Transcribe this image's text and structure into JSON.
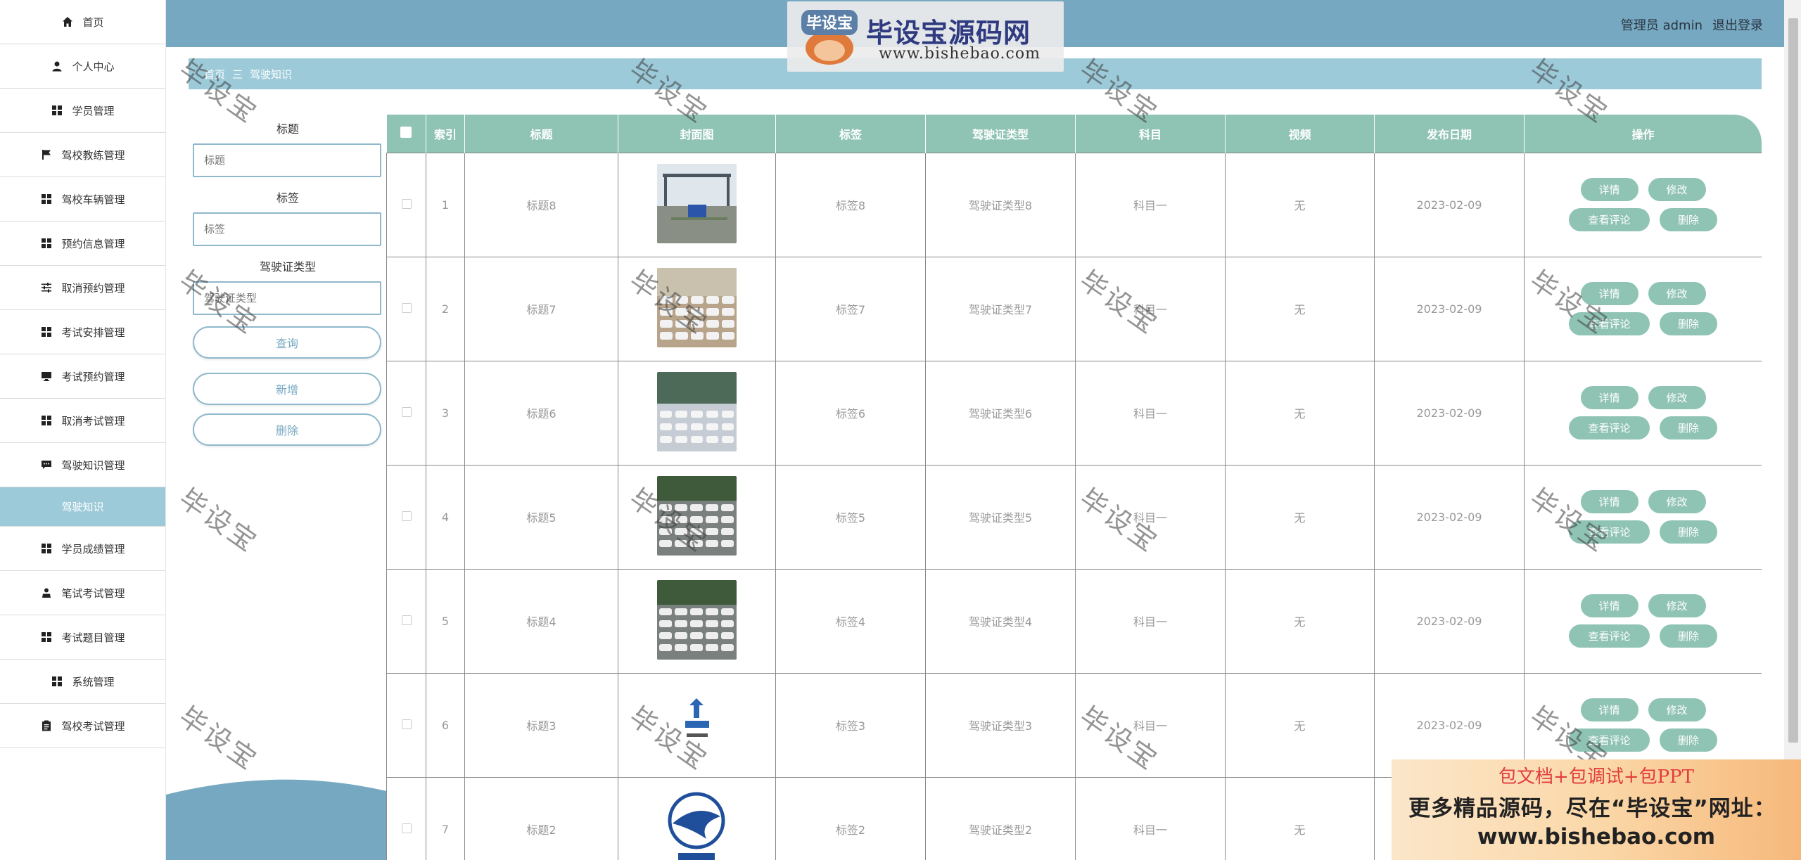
{
  "sidebar": {
    "items": [
      {
        "label": "首页",
        "icon": "home-icon"
      },
      {
        "label": "个人中心",
        "icon": "user-icon"
      },
      {
        "label": "学员管理",
        "icon": "grid-icon"
      },
      {
        "label": "驾校教练管理",
        "icon": "flag-icon"
      },
      {
        "label": "驾校车辆管理",
        "icon": "grid-icon"
      },
      {
        "label": "预约信息管理",
        "icon": "grid-icon"
      },
      {
        "label": "取消预约管理",
        "icon": "sliders-icon"
      },
      {
        "label": "考试安排管理",
        "icon": "grid-icon"
      },
      {
        "label": "考试预约管理",
        "icon": "monitor-icon"
      },
      {
        "label": "取消考试管理",
        "icon": "grid-icon"
      },
      {
        "label": "驾驶知识管理",
        "icon": "chat-icon"
      }
    ],
    "active_item": "驾驶知识",
    "items_after": [
      {
        "label": "学员成绩管理",
        "icon": "grid-icon"
      },
      {
        "label": "笔试考试管理",
        "icon": "person-icon"
      },
      {
        "label": "考试题目管理",
        "icon": "grid-icon"
      },
      {
        "label": "系统管理",
        "icon": "grid-icon"
      },
      {
        "label": "驾校考试管理",
        "icon": "clipboard-icon"
      }
    ]
  },
  "header": {
    "logo_text": "毕设宝源码网",
    "logo_url": "www.bishebao.com",
    "logo_badge": "毕设宝",
    "user_label": "管理员 admin",
    "logout_label": "退出登录"
  },
  "breadcrumb": {
    "home": "首页",
    "separator": "三",
    "current": "驾驶知识"
  },
  "search": {
    "title_label": "标题",
    "title_placeholder": "标题",
    "tag_label": "标签",
    "tag_placeholder": "标签",
    "license_label": "驾驶证类型",
    "license_placeholder": "驾驶证类型",
    "query_button": "查询",
    "add_button": "新增",
    "delete_button": "删除"
  },
  "table": {
    "columns": [
      "索引",
      "标题",
      "封面图",
      "标签",
      "驾驶证类型",
      "科目",
      "视频",
      "发布日期",
      "操作"
    ],
    "rows": [
      {
        "index": "1",
        "title": "标题8",
        "tag": "标签8",
        "license": "驾驶证类型8",
        "subject": "科目一",
        "video": "无",
        "date": "2023-02-09",
        "cover": "photo-training-ground"
      },
      {
        "index": "2",
        "title": "标题7",
        "tag": "标签7",
        "license": "驾驶证类型7",
        "subject": "科目一",
        "video": "无",
        "date": "2023-02-09",
        "cover": "photo-parked-cars"
      },
      {
        "index": "3",
        "title": "标题6",
        "tag": "标签6",
        "license": "驾驶证类型6",
        "subject": "科目一",
        "video": "无",
        "date": "2023-02-09",
        "cover": "photo-snowy-lot"
      },
      {
        "index": "4",
        "title": "标题5",
        "tag": "标签5",
        "license": "驾驶证类型5",
        "subject": "科目一",
        "video": "无",
        "date": "2023-02-09",
        "cover": "photo-car-rows"
      },
      {
        "index": "5",
        "title": "标题4",
        "tag": "标签4",
        "license": "驾驶证类型4",
        "subject": "科目一",
        "video": "无",
        "date": "2023-02-09",
        "cover": "photo-car-rows"
      },
      {
        "index": "6",
        "title": "标题3",
        "tag": "标签3",
        "license": "驾驶证类型3",
        "subject": "科目一",
        "video": "无",
        "date": "2023-02-09",
        "cover": "logo-driving-school-small"
      },
      {
        "index": "7",
        "title": "标题2",
        "tag": "标签2",
        "license": "驾驶证类型2",
        "subject": "科目一",
        "video": "无",
        "date": "",
        "cover": "logo-driving-school-eagle"
      }
    ],
    "actions": {
      "detail": "详情",
      "edit": "修改",
      "comments": "查看评论",
      "delete": "删除"
    }
  },
  "watermark_text": "毕设宝",
  "ad": {
    "line1": "包文档+包调试+包PPT",
    "line2": "更多精品源码，尽在“毕设宝”网址：",
    "line3": "www.bishebao.com"
  },
  "colors": {
    "header_blue": "#76a9c1",
    "light_blue": "#9dcad9",
    "table_green": "#8fc3b3"
  }
}
